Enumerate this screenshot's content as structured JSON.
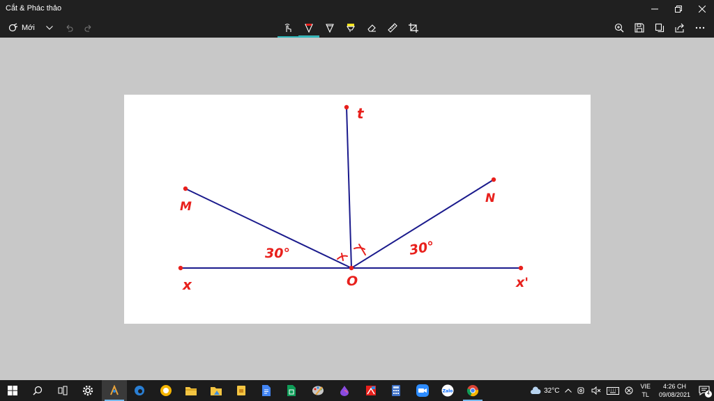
{
  "window": {
    "title": "Cắt & Phác thảo"
  },
  "toolbar": {
    "new_label": "Mới"
  },
  "drawing": {
    "labels": {
      "t": "t",
      "M": "M",
      "N": "N",
      "x": "x",
      "O": "O",
      "x_prime": "x'",
      "angle_left": "30°",
      "angle_right": "30°"
    },
    "colors": {
      "line": "#1a1a8c",
      "ink": "#e8201c"
    }
  },
  "taskbar": {
    "apps": [
      "windows-start",
      "search",
      "task-view",
      "settings",
      "snip-sketch",
      "edge-legacy",
      "edge",
      "file-explorer",
      "photos-explorer",
      "sticky-notes",
      "google-docs",
      "google-sheets",
      "paint",
      "color-drop",
      "snip-app",
      "calculator",
      "zoom",
      "zalo",
      "chrome"
    ],
    "weather": "32°C",
    "language_top": "VIE",
    "language_bottom": "TL",
    "time": "4:26 CH",
    "date": "09/08/2021",
    "notification_count": "4"
  }
}
